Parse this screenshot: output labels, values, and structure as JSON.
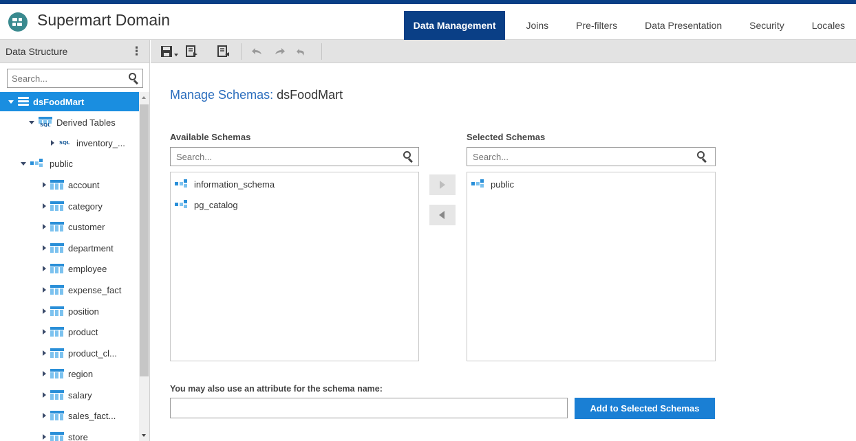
{
  "app": {
    "title": "Supermart Domain"
  },
  "tabs": [
    {
      "label": "Data Management",
      "active": true
    },
    {
      "label": "Joins",
      "active": false
    },
    {
      "label": "Pre-filters",
      "active": false
    },
    {
      "label": "Data Presentation",
      "active": false
    },
    {
      "label": "Security",
      "active": false
    },
    {
      "label": "Locales",
      "active": false
    }
  ],
  "left_panel": {
    "title": "Data Structure",
    "search_placeholder": "Search...",
    "tree": [
      {
        "label": "dsFoodMart",
        "type": "datasource",
        "expanded": true,
        "selected": true
      },
      {
        "label": "Derived Tables",
        "type": "derived",
        "expanded": true
      },
      {
        "label": "inventory_...",
        "type": "sql-table",
        "expanded": false
      },
      {
        "label": "public",
        "type": "schema",
        "expanded": true
      },
      {
        "label": "account",
        "type": "table"
      },
      {
        "label": "category",
        "type": "table"
      },
      {
        "label": "customer",
        "type": "table"
      },
      {
        "label": "department",
        "type": "table"
      },
      {
        "label": "employee",
        "type": "table"
      },
      {
        "label": "expense_fact",
        "type": "table"
      },
      {
        "label": "position",
        "type": "table"
      },
      {
        "label": "product",
        "type": "table"
      },
      {
        "label": "product_cl...",
        "type": "table"
      },
      {
        "label": "region",
        "type": "table"
      },
      {
        "label": "salary",
        "type": "table"
      },
      {
        "label": "sales_fact...",
        "type": "table"
      },
      {
        "label": "store",
        "type": "table"
      }
    ]
  },
  "toolbar": {
    "buttons": [
      "save-icon",
      "export-icon",
      "import-icon",
      "undo-icon",
      "redo-icon",
      "undo-all-icon"
    ]
  },
  "main": {
    "title_label": "Manage Schemas:",
    "title_value": "dsFoodMart",
    "available": {
      "label": "Available Schemas",
      "search_placeholder": "Search...",
      "items": [
        "information_schema",
        "pg_catalog"
      ]
    },
    "selected": {
      "label": "Selected Schemas",
      "search_placeholder": "Search...",
      "items": [
        "public"
      ]
    },
    "attribute_label": "You may also use an attribute for the schema name:",
    "attribute_value": "",
    "add_button_label": "Add to Selected Schemas"
  },
  "colors": {
    "brand": "#0a3f86",
    "accent": "#1a7fd4",
    "selected_row": "#1a8ee0",
    "title_blue": "#2a6dbd"
  }
}
